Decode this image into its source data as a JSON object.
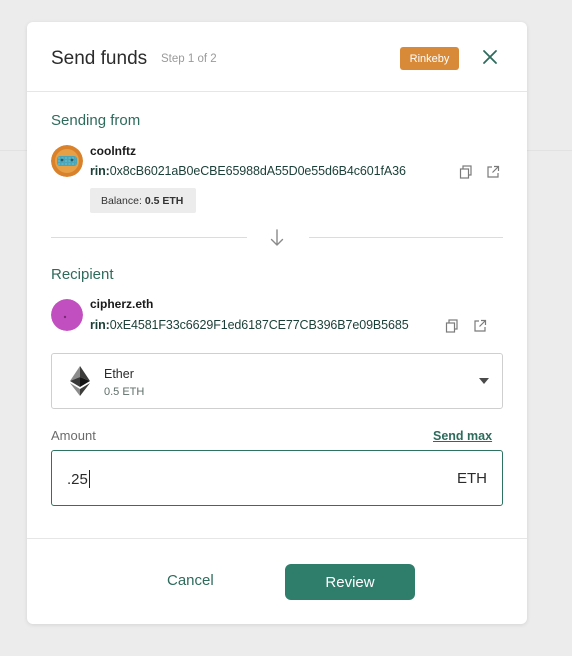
{
  "header": {
    "title": "Send funds",
    "step": "Step 1 of 2",
    "network": "Rinkeby"
  },
  "sender": {
    "section_label": "Sending from",
    "name": "coolnftz",
    "address_prefix": "rin:",
    "address": "0x8cB6021aB0eCBE65988dA55D0e55d6B4c601fA36",
    "balance_label": "Balance:",
    "balance_value": "0.5 ETH"
  },
  "recipient": {
    "section_label": "Recipient",
    "name": "cipherz.eth",
    "address_prefix": "rin:",
    "address": "0xE4581F33c6629F1ed6187CE77CB396B7e09B5685"
  },
  "asset": {
    "name": "Ether",
    "balance": "0.5 ETH"
  },
  "amount": {
    "label": "Amount",
    "send_max_label": "Send max",
    "value": ".25",
    "unit": "ETH"
  },
  "footer": {
    "cancel_label": "Cancel",
    "review_label": "Review"
  },
  "colors": {
    "accent": "#2f7d6b",
    "network_badge": "#d98a38",
    "label_green": "#2e6b5b"
  }
}
